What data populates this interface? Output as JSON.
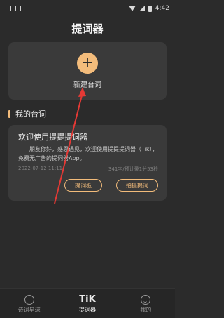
{
  "status_bar": {
    "time": "4:42",
    "icons": [
      "notification-box-icon",
      "sim-icon",
      "wifi-icon",
      "signal-icon",
      "battery-icon"
    ]
  },
  "header": {
    "title": "提词器"
  },
  "new_script": {
    "icon": "plus-icon",
    "label": "新建台词"
  },
  "section": {
    "title": "我的台词"
  },
  "script_card": {
    "title": "欢迎使用提提提词器",
    "body": "朋友你好，感恩遇见，欢迎使用提提提词器（Tik），免费无广告的提词器App。",
    "date": "2022-07-12 11:11",
    "stats": "341字/预计录1分53秒",
    "buttons": {
      "edit": "提词板",
      "shoot": "拍摄提词"
    }
  },
  "tabbar": {
    "items": [
      {
        "label": "诗词星球",
        "icon": "planet-icon"
      },
      {
        "label": "提词器",
        "icon": "tik-logo-icon",
        "icon_text": "TiK"
      },
      {
        "label": "我的",
        "icon": "smile-icon"
      }
    ]
  },
  "colors": {
    "accent": "#f3bc7b",
    "background": "#2b2b2b",
    "card": "#3a3a3a",
    "pointer": "#e53935"
  }
}
